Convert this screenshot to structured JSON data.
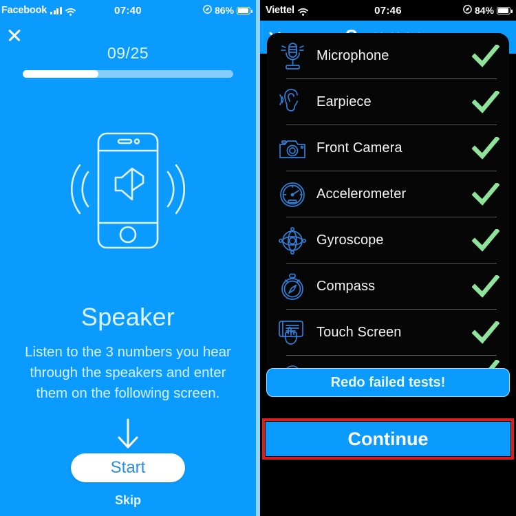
{
  "left": {
    "status_bar": {
      "carrier": "Facebook",
      "time": "07:40",
      "battery": "86%",
      "signal_icon": "signal-bars-icon",
      "wifi_icon": "wifi-icon",
      "battery_icon": "battery-icon",
      "location_icon": "location-arrow-icon"
    },
    "close_label": "close-icon",
    "counter": "09/25",
    "progress_percent": 36,
    "illustration_icon": "phone-speaker-illustration",
    "title": "Speaker",
    "description": "Listen to the 3 numbers you hear through the speakers and enter them on the following screen.",
    "arrow_icon": "arrow-down-icon",
    "start_label": "Start",
    "skip_label": "Skip"
  },
  "right": {
    "status_bar": {
      "carrier": "Viettel",
      "time": "07:46",
      "battery": "84%",
      "wifi_icon": "wifi-icon",
      "battery_icon": "battery-icon",
      "location_icon": "location-arrow-icon"
    },
    "close_label": "close-icon",
    "header_title": "Summary",
    "rows": [
      {
        "icon": "microphone-icon",
        "label": "Microphone",
        "status": "pass"
      },
      {
        "icon": "earpiece-icon",
        "label": "Earpiece",
        "status": "pass"
      },
      {
        "icon": "front-camera-icon",
        "label": "Front Camera",
        "status": "pass"
      },
      {
        "icon": "accelerometer-icon",
        "label": "Accelerometer",
        "status": "pass"
      },
      {
        "icon": "gyroscope-icon",
        "label": "Gyroscope",
        "status": "pass"
      },
      {
        "icon": "compass-icon",
        "label": "Compass",
        "status": "pass"
      },
      {
        "icon": "touch-screen-icon",
        "label": "Touch Screen",
        "status": "pass"
      },
      {
        "icon": "next-test-icon",
        "label": "",
        "status": "pass"
      }
    ],
    "redo_label": "Redo failed tests!",
    "continue_label": "Continue",
    "highlight_color": "#e01b1b"
  },
  "colors": {
    "brand_blue": "#0b9bff",
    "check_green": "#8fe39a",
    "icon_blue": "#2f7fd8",
    "card_black": "#060606"
  }
}
